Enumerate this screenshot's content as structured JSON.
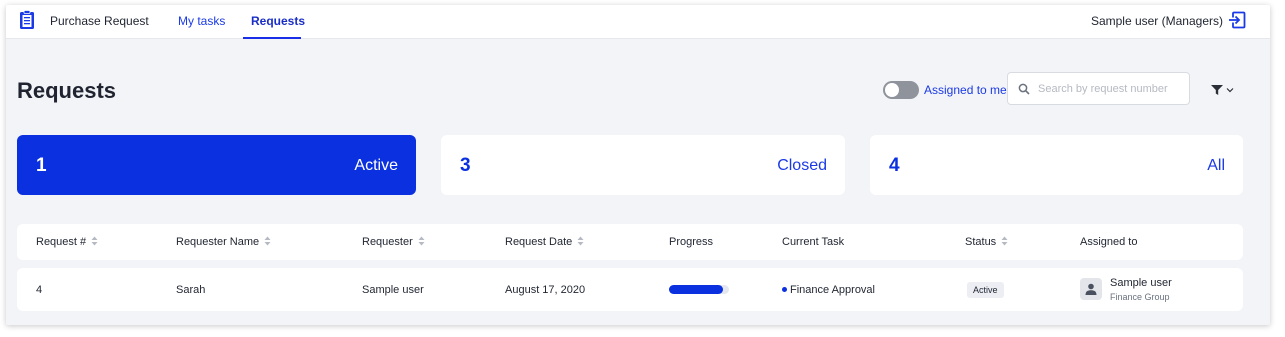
{
  "app": {
    "title": "Purchase Request",
    "nav": [
      {
        "label": "My tasks",
        "active": false
      },
      {
        "label": "Requests",
        "active": true
      }
    ],
    "user_label": "Sample user (Managers)"
  },
  "header": {
    "title": "Requests",
    "assigned_toggle_label": "Assigned to me",
    "assigned_toggle_on": false,
    "search_placeholder": "Search by request number",
    "search_value": ""
  },
  "summary_cards": [
    {
      "count": "1",
      "label": "Active",
      "selected": true
    },
    {
      "count": "3",
      "label": "Closed",
      "selected": false
    },
    {
      "count": "4",
      "label": "All",
      "selected": false
    }
  ],
  "table": {
    "columns": [
      {
        "label": "Request #",
        "sortable": true
      },
      {
        "label": "Requester Name",
        "sortable": true
      },
      {
        "label": "Requester",
        "sortable": true
      },
      {
        "label": "Request Date",
        "sortable": true
      },
      {
        "label": "Progress",
        "sortable": false
      },
      {
        "label": "Current Task",
        "sortable": false
      },
      {
        "label": "Status",
        "sortable": true
      },
      {
        "label": "Assigned to",
        "sortable": false
      }
    ],
    "rows": [
      {
        "request_no": "4",
        "requester_name": "Sarah",
        "requester": "Sample user",
        "request_date": "August 17, 2020",
        "progress": 0.9,
        "current_task": "Finance Approval",
        "status": "Active",
        "assignee_name": "Sample user",
        "assignee_group": "Finance Group"
      }
    ]
  },
  "colors": {
    "primary": "#0a30e0",
    "link": "#1a3ae8",
    "background": "#f3f4f7"
  },
  "icons": [
    "clipboard-icon",
    "logout-icon",
    "search-icon",
    "filter-icon",
    "chevron-down-icon",
    "sort-icon",
    "user-icon"
  ]
}
